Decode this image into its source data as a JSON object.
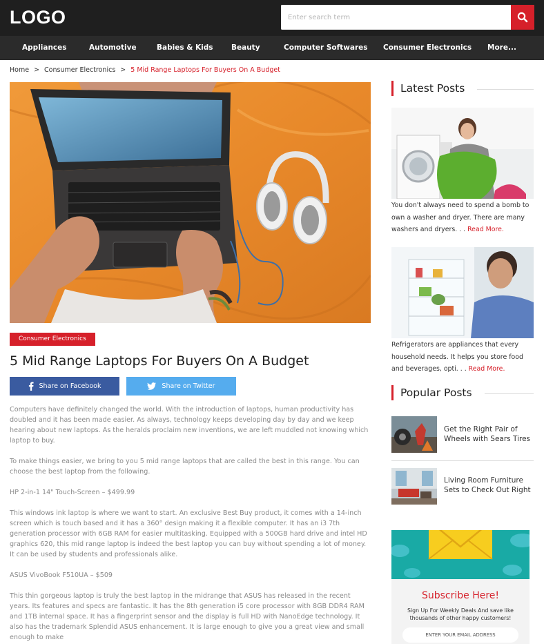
{
  "header": {
    "logo": "LOGO",
    "search_placeholder": "Enter search term",
    "search_icon": "search-icon"
  },
  "nav": {
    "items": [
      "Appliances",
      "Automotive",
      "Babies & Kids",
      "Beauty",
      "Computer Softwares",
      "Consumer Electronics",
      "More..."
    ]
  },
  "breadcrumb": {
    "home": "Home",
    "category": "Consumer Electronics",
    "separator": ">",
    "current": "5 Mid Range Laptops For Buyers On A Budget"
  },
  "article": {
    "category": "Consumer Electronics",
    "title": "5 Mid Range Laptops For Buyers On A Budget",
    "share_facebook": "Share on Facebook",
    "share_twitter": "Share on Twitter",
    "paragraphs": [
      "Computers have definitely changed the world. With the introduction of laptops, human productivity has doubled and it has been made easier. As always, technology keeps developing day by day and we keep hearing about new laptops. As the heralds proclaim new inventions, we are left muddled not knowing which laptop to buy.",
      "To make things easier, we bring to you 5 mid range laptops that are called the best in this range. You can choose the best laptop from the following.",
      "HP 2-in-1 14\" Touch-Screen – $499.99",
      "This windows ink laptop is where we want to start. An exclusive Best Buy product, it comes with a 14-inch screen which is touch based and it has a 360° design making it a flexible computer. It has an i3 7th generation processor with 6GB RAM for easier multitasking. Equipped with a 500GB hard drive and intel HD graphics 620, this mid range laptop is indeed the best laptop you can buy without spending a lot of money. It can be used by students and professionals alike.",
      "ASUS VivoBook F510UA – $509",
      "This thin gorgeous laptop is truly the best laptop in the midrange that ASUS has released in the recent years. Its features and specs are fantastic. It has the 8th generation i5 core processor with 8GB DDR4 RAM and 1TB internal space. It has a fingerprint sensor and the display is full HD with NanoEdge technology. It also has the trademark Splendid ASUS enhancement. It is large enough to give you a great view and small enough to make"
    ]
  },
  "sidebar": {
    "latest_heading": "Latest Posts",
    "latest": [
      {
        "text": "You don't always need to spend a bomb to own a washer and dryer. There are many washers and dryers. . .",
        "more": "Read More."
      },
      {
        "text": "Refrigerators are appliances that every household needs. It helps you store food and beverages, opti. . .",
        "more": "Read More."
      }
    ],
    "popular_heading": "Popular Posts",
    "popular": [
      {
        "title": "Get the Right Pair of Wheels with Sears Tires"
      },
      {
        "title": "Living Room Furniture Sets to Check Out Right"
      }
    ],
    "subscribe": {
      "title": "Subscribe Here!",
      "description": "Sign Up For Weekly Deals And save like thousands of other happy customers!",
      "email_placeholder": "ENTER YOUR EMAIL ADDRESS"
    }
  },
  "colors": {
    "accent": "#d6202a",
    "header_bg": "#1f1f1f",
    "nav_bg": "#2b2b2b",
    "facebook": "#3a5ba0",
    "twitter": "#55acee",
    "subscribe_teal": "#19aaa5",
    "envelope": "#f7cd1f"
  }
}
